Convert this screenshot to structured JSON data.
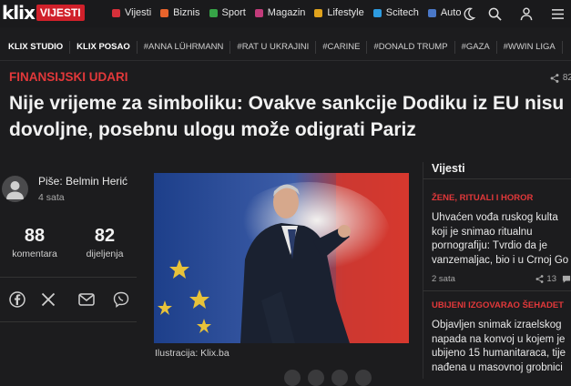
{
  "header": {
    "logo_text": "klix",
    "logo_badge": "VIJESTI",
    "categories": [
      {
        "label": "Vijesti",
        "color": "#d6303a"
      },
      {
        "label": "Biznis",
        "color": "#e8642c"
      },
      {
        "label": "Sport",
        "color": "#36a447"
      },
      {
        "label": "Magazin",
        "color": "#c23b7a"
      },
      {
        "label": "Lifestyle",
        "color": "#e0a21c"
      },
      {
        "label": "Scitech",
        "color": "#2d9be0"
      },
      {
        "label": "Auto",
        "color": "#4a78c8"
      }
    ],
    "icons": [
      "moon-icon",
      "search-icon",
      "user-icon",
      "menu-icon"
    ]
  },
  "tags": [
    "KLIX STUDIO",
    "KLIX POSAO",
    "#ANNA LÜHRMANN",
    "#RAT U UKRAJINI",
    "#CARINE",
    "#DONALD TRUMP",
    "#GAZA",
    "#WWIN LIGA"
  ],
  "article": {
    "kicker": "FINANSIJSKI UDARI",
    "share_count": "82",
    "title": "Nije vrijeme za simboliku: Ovakve sankcije Dodiku iz EU nisu dovoljne, posebnu ulogu može odigrati Pariz",
    "author": "Piše: Belmin Herić",
    "time": "4 sata",
    "comments_count": "88",
    "comments_label": "komentara",
    "shares_count": "82",
    "shares_label": "dijeljenja",
    "caption": "Ilustracija: Klix.ba"
  },
  "rail": {
    "title": "Vijesti",
    "items": [
      {
        "kicker": "ŽENE, RITUALI I HOROR",
        "lines": [
          "Uhvaćen vođa ruskog kulta",
          "koji je snimao ritualnu",
          "pornografiju: Tvrdio da je",
          "vanzemaljac, bio i u Crnoj Go"
        ],
        "time": "2 sata",
        "shares": "13"
      },
      {
        "kicker": "UBIJENI IZGOVARAO ŠEHADET",
        "lines": [
          "Objavljen snimak izraelskog",
          "napada na konvoj u kojem je",
          "ubijeno 15 humanitaraca, tije",
          "nađena u masovnoj grobnici"
        ]
      }
    ]
  }
}
